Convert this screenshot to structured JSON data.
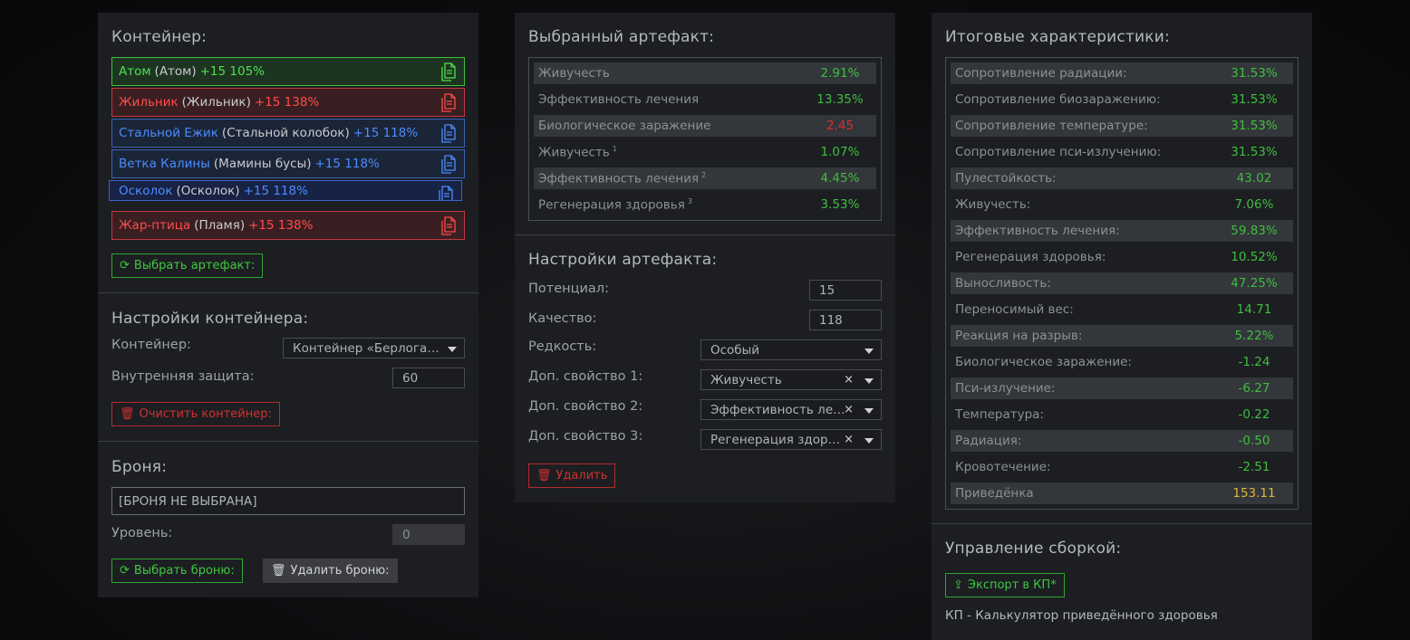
{
  "colors": {
    "green": "#3fbf3f",
    "red": "#d93030",
    "blue": "#4b8cff",
    "gold": "#e0b53a"
  },
  "container": {
    "title": "Контейнер:",
    "slots": [
      {
        "name": "Атом",
        "base": "(Атом)",
        "level": "+15 105%",
        "color": "green",
        "icon": "document-icon"
      },
      {
        "name": "Жильник",
        "base": "(Жильник)",
        "level": "+15 138%",
        "color": "red",
        "icon": "document-icon"
      },
      {
        "name": "Стальной Ежик",
        "base": "(Стальной колобок)",
        "level": "+15 118%",
        "color": "blue",
        "icon": "document-icon"
      },
      {
        "name": "Ветка Калины",
        "base": "(Мамины бусы)",
        "level": "+15 118%",
        "color": "blue",
        "icon": "document-icon"
      },
      {
        "name": "Осколок",
        "base": "(Осколок)",
        "level": "+15 118%",
        "color": "blue",
        "icon": "document-icon"
      },
      {
        "name": "Жар-птица",
        "base": "(Пламя)",
        "level": "+15 138%",
        "color": "red",
        "icon": "document-icon"
      }
    ],
    "choose_button": "Выбрать артефакт:"
  },
  "container_settings": {
    "title": "Настройки контейнера:",
    "container_label": "Контейнер:",
    "container_value": "Контейнер «Берлога…",
    "protection_label": "Внутренняя защита:",
    "protection_value": "60",
    "clear_button": "Очистить контейнер:"
  },
  "armor": {
    "title": "Броня:",
    "armor_value": "[БРОНЯ НЕ ВЫБРАНА]",
    "level_label": "Уровень:",
    "level_value": "0",
    "choose_button": "Выбрать броню:",
    "remove_button": "Удалить броню:"
  },
  "selected_artifact": {
    "title": "Выбранный артефакт:",
    "stats": [
      {
        "name": "Живучесть",
        "sup": "",
        "value": "2.91%",
        "tone": "pos"
      },
      {
        "name": "Эффективность лечения",
        "sup": "",
        "value": "13.35%",
        "tone": "pos"
      },
      {
        "name": "Биологическое заражение",
        "sup": "",
        "value": "2.45",
        "tone": "neg"
      },
      {
        "name": "Живучесть",
        "sup": "1",
        "value": "1.07%",
        "tone": "pos"
      },
      {
        "name": "Эффективность лечения",
        "sup": "2",
        "value": "4.45%",
        "tone": "pos"
      },
      {
        "name": "Регенерация здоровья",
        "sup": "3",
        "value": "3.53%",
        "tone": "pos"
      }
    ]
  },
  "artifact_settings": {
    "title": "Настройки артефакта:",
    "potential_label": "Потенциал:",
    "potential_value": "15",
    "quality_label": "Качество:",
    "quality_value": "118",
    "rarity_label": "Редкость:",
    "rarity_value": "Особый",
    "prop1_label": "Доп. свойство 1:",
    "prop1_value": "Живучесть",
    "prop2_label": "Доп. свойство 2:",
    "prop2_value": "Эффективность ле…",
    "prop3_label": "Доп. свойство 3:",
    "prop3_value": "Регенерация здор…",
    "clear_symbol": "×",
    "delete_button": "Удалить"
  },
  "totals": {
    "title": "Итоговые характеристики:",
    "stats": [
      {
        "name": "Сопротивление радиации:",
        "value": "31.53%",
        "tone": "pos"
      },
      {
        "name": "Сопротивление биозаражению:",
        "value": "31.53%",
        "tone": "pos"
      },
      {
        "name": "Сопротивление температуре:",
        "value": "31.53%",
        "tone": "pos"
      },
      {
        "name": "Сопротивление пси-излучению:",
        "value": "31.53%",
        "tone": "pos"
      },
      {
        "name": "Пулестойкость:",
        "value": "43.02",
        "tone": "pos"
      },
      {
        "name": "Живучесть:",
        "value": "7.06%",
        "tone": "pos"
      },
      {
        "name": "Эффективность лечения:",
        "value": "59.83%",
        "tone": "pos"
      },
      {
        "name": "Регенерация здоровья:",
        "value": "10.52%",
        "tone": "pos"
      },
      {
        "name": "Выносливость:",
        "value": "47.25%",
        "tone": "pos"
      },
      {
        "name": "Переносимый вес:",
        "value": "14.71",
        "tone": "pos"
      },
      {
        "name": "Реакция на разрыв:",
        "value": "5.22%",
        "tone": "pos"
      },
      {
        "name": "Биологическое заражение:",
        "value": "-1.24",
        "tone": "pos"
      },
      {
        "name": "Пси-излучение:",
        "value": "-6.27",
        "tone": "pos"
      },
      {
        "name": "Температура:",
        "value": "-0.22",
        "tone": "pos"
      },
      {
        "name": "Радиация:",
        "value": "-0.50",
        "tone": "pos"
      },
      {
        "name": "Кровотечение:",
        "value": "-2.51",
        "tone": "pos"
      },
      {
        "name": "Приведёнка",
        "value": "153.11",
        "tone": "gold"
      }
    ]
  },
  "build": {
    "title": "Управление сборкой:",
    "export_button": "Экспорт в КП*",
    "footnote": "КП - Калькулятор приведённого здоровья"
  }
}
